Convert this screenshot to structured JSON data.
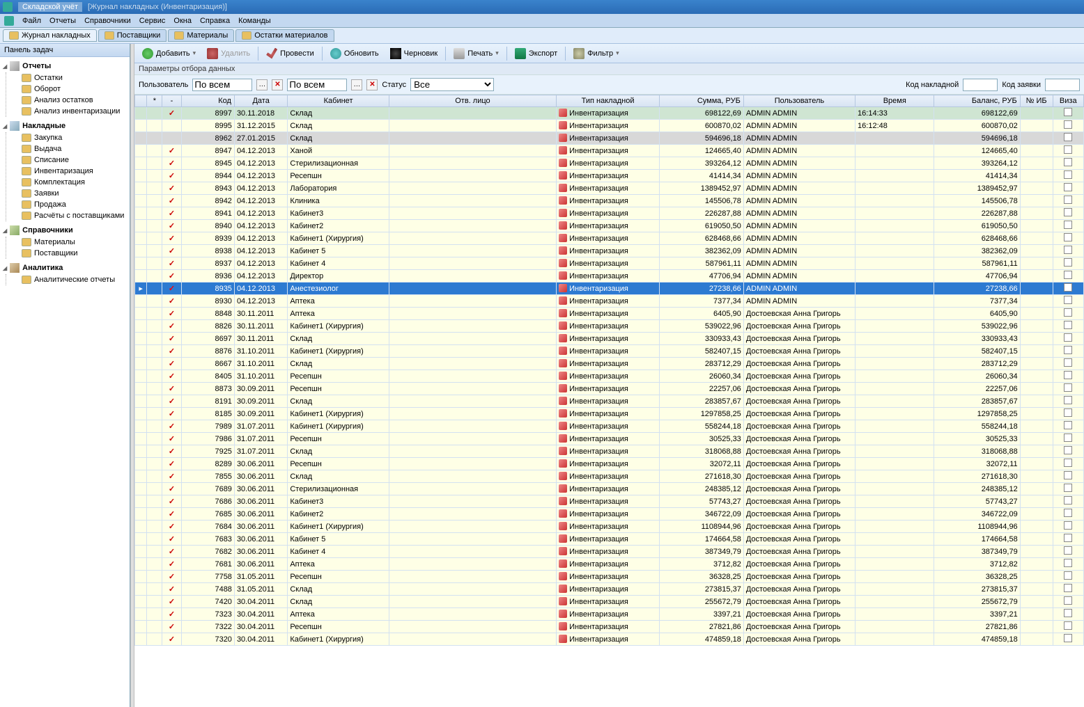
{
  "title": {
    "app": "Складской учёт",
    "sub": "[Журнал накладных  (Инвентаризация)]"
  },
  "menu": [
    "Файл",
    "Отчеты",
    "Справочники",
    "Сервис",
    "Окна",
    "Справка",
    "Команды"
  ],
  "tabs": [
    {
      "label": "Журнал накладных",
      "active": true
    },
    {
      "label": "Поставщики",
      "active": false
    },
    {
      "label": "Материалы",
      "active": false
    },
    {
      "label": "Остатки материалов",
      "active": false
    }
  ],
  "sidebar": {
    "title": "Панель задач",
    "groups": [
      {
        "name": "Отчеты",
        "icon": "reports",
        "items": [
          "Остатки",
          "Оборот",
          "Анализ остатков",
          "Анализ инвентаризации"
        ]
      },
      {
        "name": "Накладные",
        "icon": "docs",
        "items": [
          "Закупка",
          "Выдача",
          "Списание",
          "Инвентаризация",
          "Комплектация",
          "Заявки",
          "Продажа",
          "Расчёты с поставщиками"
        ]
      },
      {
        "name": "Справочники",
        "icon": "refs",
        "items": [
          "Материалы",
          "Поставщики"
        ]
      },
      {
        "name": "Аналитика",
        "icon": "analytics",
        "items": [
          "Аналитические отчеты"
        ]
      }
    ]
  },
  "toolbar": [
    {
      "label": "Добавить",
      "icon": "add",
      "dd": true
    },
    {
      "label": "Удалить",
      "icon": "del",
      "disabled": true
    },
    {
      "sep": true
    },
    {
      "label": "Провести",
      "icon": "ok"
    },
    {
      "sep": true
    },
    {
      "label": "Обновить",
      "icon": "refresh"
    },
    {
      "label": "Черновик",
      "icon": "draft"
    },
    {
      "sep": true
    },
    {
      "label": "Печать",
      "icon": "print",
      "dd": true
    },
    {
      "sep": true
    },
    {
      "label": "Экспорт",
      "icon": "export"
    },
    {
      "sep": true
    },
    {
      "label": "Фильтр",
      "icon": "filter",
      "dd": true
    }
  ],
  "params_header": "Параметры отбора данных",
  "filters": {
    "user_label": "Пользователь",
    "user_all": "По всем",
    "user_all2": "По всем",
    "status_label": "Статус",
    "status_val": "Все",
    "code_label": "Код накладной",
    "req_label": "Код заявки"
  },
  "columns": [
    "",
    "*",
    "-",
    "Код",
    "Дата",
    "Кабинет",
    "Отв. лицо",
    "Тип накладной",
    "Сумма, РУБ",
    "Пользователь",
    "Время",
    "Баланс, РУБ",
    "№ ИБ",
    "Виза"
  ],
  "rows": [
    {
      "check": true,
      "code": "8997",
      "date": "30.11.2018",
      "cab": "Склад",
      "type": "Инвентаризация",
      "sum": "698122,69",
      "user": "ADMIN ADMIN",
      "time": "16:14:33",
      "bal": "698122,69",
      "cls": "dark"
    },
    {
      "check": false,
      "code": "8995",
      "date": "31.12.2015",
      "cab": "Склад",
      "type": "Инвентаризация",
      "sum": "600870,02",
      "user": "ADMIN ADMIN",
      "time": "16:12:48",
      "bal": "600870,02"
    },
    {
      "check": false,
      "code": "8962",
      "date": "27.01.2015",
      "cab": "Склад",
      "type": "Инвентаризация",
      "sum": "594696,18",
      "user": "ADMIN ADMIN",
      "time": "",
      "bal": "594696,18",
      "cls": "gray"
    },
    {
      "check": true,
      "code": "8947",
      "date": "04.12.2013",
      "cab": "Ханой",
      "type": "Инвентаризация",
      "sum": "124665,40",
      "user": "ADMIN ADMIN",
      "time": "",
      "bal": "124665,40"
    },
    {
      "check": true,
      "code": "8945",
      "date": "04.12.2013",
      "cab": "Стерилизационная",
      "type": "Инвентаризация",
      "sum": "393264,12",
      "user": "ADMIN ADMIN",
      "time": "",
      "bal": "393264,12"
    },
    {
      "check": true,
      "code": "8944",
      "date": "04.12.2013",
      "cab": "Ресепшн",
      "type": "Инвентаризация",
      "sum": "41414,34",
      "user": "ADMIN ADMIN",
      "time": "",
      "bal": "41414,34"
    },
    {
      "check": true,
      "code": "8943",
      "date": "04.12.2013",
      "cab": "Лаборатория",
      "type": "Инвентаризация",
      "sum": "1389452,97",
      "user": "ADMIN ADMIN",
      "time": "",
      "bal": "1389452,97"
    },
    {
      "check": true,
      "code": "8942",
      "date": "04.12.2013",
      "cab": "Клиника",
      "type": "Инвентаризация",
      "sum": "145506,78",
      "user": "ADMIN ADMIN",
      "time": "",
      "bal": "145506,78"
    },
    {
      "check": true,
      "code": "8941",
      "date": "04.12.2013",
      "cab": "Кабинет3",
      "type": "Инвентаризация",
      "sum": "226287,88",
      "user": "ADMIN ADMIN",
      "time": "",
      "bal": "226287,88"
    },
    {
      "check": true,
      "code": "8940",
      "date": "04.12.2013",
      "cab": "Кабинет2",
      "type": "Инвентаризация",
      "sum": "619050,50",
      "user": "ADMIN ADMIN",
      "time": "",
      "bal": "619050,50"
    },
    {
      "check": true,
      "code": "8939",
      "date": "04.12.2013",
      "cab": "Кабинет1 (Хирургия)",
      "type": "Инвентаризация",
      "sum": "628468,66",
      "user": "ADMIN ADMIN",
      "time": "",
      "bal": "628468,66"
    },
    {
      "check": true,
      "code": "8938",
      "date": "04.12.2013",
      "cab": "Кабинет 5",
      "type": "Инвентаризация",
      "sum": "382362,09",
      "user": "ADMIN ADMIN",
      "time": "",
      "bal": "382362,09"
    },
    {
      "check": true,
      "code": "8937",
      "date": "04.12.2013",
      "cab": "Кабинет 4",
      "type": "Инвентаризация",
      "sum": "587961,11",
      "user": "ADMIN ADMIN",
      "time": "",
      "bal": "587961,11"
    },
    {
      "check": true,
      "code": "8936",
      "date": "04.12.2013",
      "cab": "Директор",
      "type": "Инвентаризация",
      "sum": "47706,94",
      "user": "ADMIN ADMIN",
      "time": "",
      "bal": "47706,94"
    },
    {
      "check": true,
      "code": "8935",
      "date": "04.12.2013",
      "cab": "Анестезиолог",
      "type": "Инвентаризация",
      "sum": "27238,66",
      "user": "ADMIN ADMIN",
      "time": "",
      "bal": "27238,66",
      "cls": "sel",
      "ind": "▸"
    },
    {
      "check": true,
      "code": "8930",
      "date": "04.12.2013",
      "cab": "Аптека",
      "type": "Инвентаризация",
      "sum": "7377,34",
      "user": "ADMIN ADMIN",
      "time": "",
      "bal": "7377,34"
    },
    {
      "check": true,
      "code": "8848",
      "date": "30.11.2011",
      "cab": "Аптека",
      "type": "Инвентаризация",
      "sum": "6405,90",
      "user": "Достоевская Анна Григорь",
      "time": "",
      "bal": "6405,90"
    },
    {
      "check": true,
      "code": "8826",
      "date": "30.11.2011",
      "cab": "Кабинет1 (Хирургия)",
      "type": "Инвентаризация",
      "sum": "539022,96",
      "user": "Достоевская Анна Григорь",
      "time": "",
      "bal": "539022,96"
    },
    {
      "check": true,
      "code": "8697",
      "date": "30.11.2011",
      "cab": "Склад",
      "type": "Инвентаризация",
      "sum": "330933,43",
      "user": "Достоевская Анна Григорь",
      "time": "",
      "bal": "330933,43"
    },
    {
      "check": true,
      "code": "8876",
      "date": "31.10.2011",
      "cab": "Кабинет1 (Хирургия)",
      "type": "Инвентаризация",
      "sum": "582407,15",
      "user": "Достоевская Анна Григорь",
      "time": "",
      "bal": "582407,15"
    },
    {
      "check": true,
      "code": "8667",
      "date": "31.10.2011",
      "cab": "Склад",
      "type": "Инвентаризация",
      "sum": "283712,29",
      "user": "Достоевская Анна Григорь",
      "time": "",
      "bal": "283712,29"
    },
    {
      "check": true,
      "code": "8405",
      "date": "31.10.2011",
      "cab": "Ресепшн",
      "type": "Инвентаризация",
      "sum": "26060,34",
      "user": "Достоевская Анна Григорь",
      "time": "",
      "bal": "26060,34"
    },
    {
      "check": true,
      "code": "8873",
      "date": "30.09.2011",
      "cab": "Ресепшн",
      "type": "Инвентаризация",
      "sum": "22257,06",
      "user": "Достоевская Анна Григорь",
      "time": "",
      "bal": "22257,06"
    },
    {
      "check": true,
      "code": "8191",
      "date": "30.09.2011",
      "cab": "Склад",
      "type": "Инвентаризация",
      "sum": "283857,67",
      "user": "Достоевская Анна Григорь",
      "time": "",
      "bal": "283857,67"
    },
    {
      "check": true,
      "code": "8185",
      "date": "30.09.2011",
      "cab": "Кабинет1 (Хирургия)",
      "type": "Инвентаризация",
      "sum": "1297858,25",
      "user": "Достоевская Анна Григорь",
      "time": "",
      "bal": "1297858,25"
    },
    {
      "check": true,
      "code": "7989",
      "date": "31.07.2011",
      "cab": "Кабинет1 (Хирургия)",
      "type": "Инвентаризация",
      "sum": "558244,18",
      "user": "Достоевская Анна Григорь",
      "time": "",
      "bal": "558244,18"
    },
    {
      "check": true,
      "code": "7986",
      "date": "31.07.2011",
      "cab": "Ресепшн",
      "type": "Инвентаризация",
      "sum": "30525,33",
      "user": "Достоевская Анна Григорь",
      "time": "",
      "bal": "30525,33"
    },
    {
      "check": true,
      "code": "7925",
      "date": "31.07.2011",
      "cab": "Склад",
      "type": "Инвентаризация",
      "sum": "318068,88",
      "user": "Достоевская Анна Григорь",
      "time": "",
      "bal": "318068,88"
    },
    {
      "check": true,
      "code": "8289",
      "date": "30.06.2011",
      "cab": "Ресепшн",
      "type": "Инвентаризация",
      "sum": "32072,11",
      "user": "Достоевская Анна Григорь",
      "time": "",
      "bal": "32072,11"
    },
    {
      "check": true,
      "code": "7855",
      "date": "30.06.2011",
      "cab": "Склад",
      "type": "Инвентаризация",
      "sum": "271618,30",
      "user": "Достоевская Анна Григорь",
      "time": "",
      "bal": "271618,30"
    },
    {
      "check": true,
      "code": "7689",
      "date": "30.06.2011",
      "cab": "Стерилизационная",
      "type": "Инвентаризация",
      "sum": "248385,12",
      "user": "Достоевская Анна Григорь",
      "time": "",
      "bal": "248385,12"
    },
    {
      "check": true,
      "code": "7686",
      "date": "30.06.2011",
      "cab": "Кабинет3",
      "type": "Инвентаризация",
      "sum": "57743,27",
      "user": "Достоевская Анна Григорь",
      "time": "",
      "bal": "57743,27"
    },
    {
      "check": true,
      "code": "7685",
      "date": "30.06.2011",
      "cab": "Кабинет2",
      "type": "Инвентаризация",
      "sum": "346722,09",
      "user": "Достоевская Анна Григорь",
      "time": "",
      "bal": "346722,09"
    },
    {
      "check": true,
      "code": "7684",
      "date": "30.06.2011",
      "cab": "Кабинет1 (Хирургия)",
      "type": "Инвентаризация",
      "sum": "1108944,96",
      "user": "Достоевская Анна Григорь",
      "time": "",
      "bal": "1108944,96"
    },
    {
      "check": true,
      "code": "7683",
      "date": "30.06.2011",
      "cab": "Кабинет 5",
      "type": "Инвентаризация",
      "sum": "174664,58",
      "user": "Достоевская Анна Григорь",
      "time": "",
      "bal": "174664,58"
    },
    {
      "check": true,
      "code": "7682",
      "date": "30.06.2011",
      "cab": "Кабинет 4",
      "type": "Инвентаризация",
      "sum": "387349,79",
      "user": "Достоевская Анна Григорь",
      "time": "",
      "bal": "387349,79"
    },
    {
      "check": true,
      "code": "7681",
      "date": "30.06.2011",
      "cab": "Аптека",
      "type": "Инвентаризация",
      "sum": "3712,82",
      "user": "Достоевская Анна Григорь",
      "time": "",
      "bal": "3712,82"
    },
    {
      "check": true,
      "code": "7758",
      "date": "31.05.2011",
      "cab": "Ресепшн",
      "type": "Инвентаризация",
      "sum": "36328,25",
      "user": "Достоевская Анна Григорь",
      "time": "",
      "bal": "36328,25"
    },
    {
      "check": true,
      "code": "7488",
      "date": "31.05.2011",
      "cab": "Склад",
      "type": "Инвентаризация",
      "sum": "273815,37",
      "user": "Достоевская Анна Григорь",
      "time": "",
      "bal": "273815,37"
    },
    {
      "check": true,
      "code": "7420",
      "date": "30.04.2011",
      "cab": "Склад",
      "type": "Инвентаризация",
      "sum": "255672,79",
      "user": "Достоевская Анна Григорь",
      "time": "",
      "bal": "255672,79"
    },
    {
      "check": true,
      "code": "7323",
      "date": "30.04.2011",
      "cab": "Аптека",
      "type": "Инвентаризация",
      "sum": "3397,21",
      "user": "Достоевская Анна Григорь",
      "time": "",
      "bal": "3397,21"
    },
    {
      "check": true,
      "code": "7322",
      "date": "30.04.2011",
      "cab": "Ресепшн",
      "type": "Инвентаризация",
      "sum": "27821,86",
      "user": "Достоевская Анна Григорь",
      "time": "",
      "bal": "27821,86"
    },
    {
      "check": true,
      "code": "7320",
      "date": "30.04.2011",
      "cab": "Кабинет1 (Хирургия)",
      "type": "Инвентаризация",
      "sum": "474859,18",
      "user": "Достоевская Анна Григорь",
      "time": "",
      "bal": "474859,18"
    }
  ]
}
